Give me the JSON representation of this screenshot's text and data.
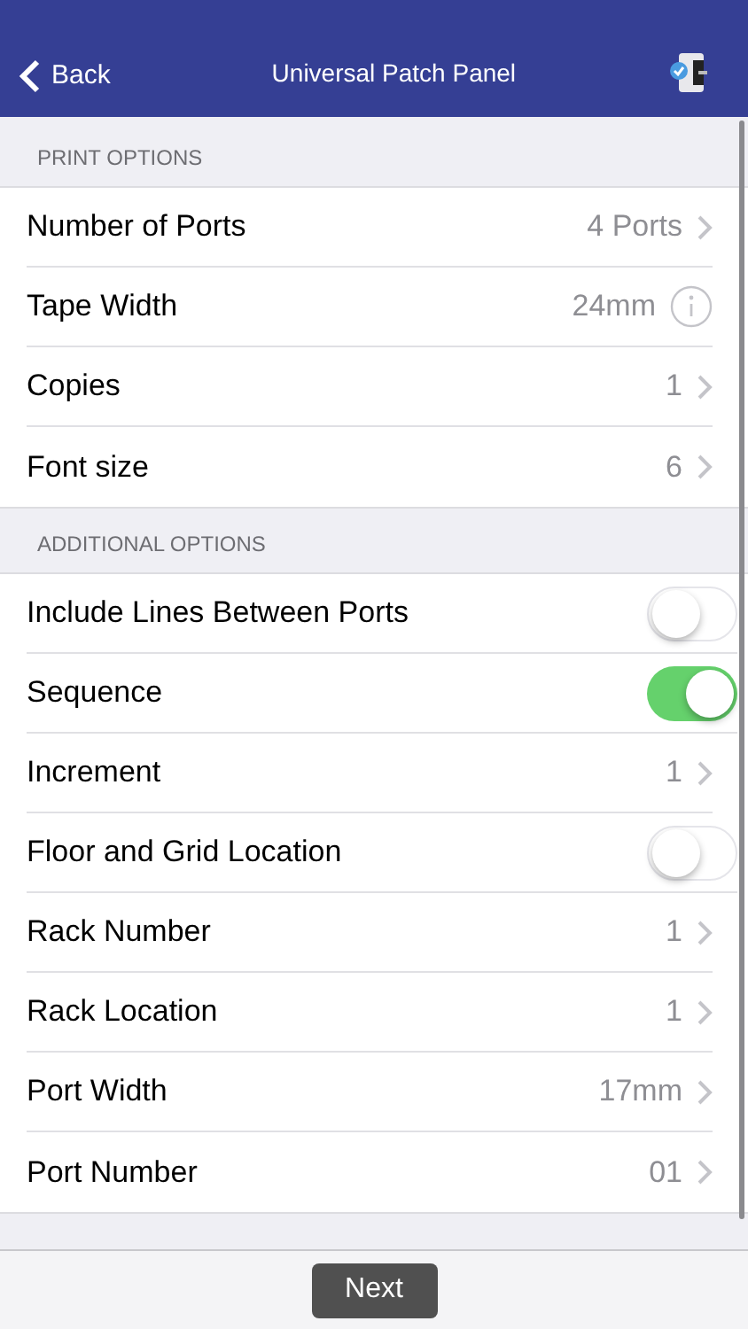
{
  "nav_bar": {
    "back": "Back",
    "title": "Universal Patch Panel"
  },
  "sections": [
    {
      "header": "PRINT OPTIONS",
      "rows": [
        {
          "kind": "disclosure",
          "label": "Number of Ports",
          "value": "4 Ports"
        },
        {
          "kind": "info",
          "label": "Tape Width",
          "value": "24mm"
        },
        {
          "kind": "disclosure",
          "label": "Copies",
          "value": "1"
        },
        {
          "kind": "disclosure",
          "label": "Font size",
          "value": "6"
        }
      ]
    },
    {
      "header": "ADDITIONAL OPTIONS",
      "rows": [
        {
          "kind": "toggle",
          "label": "Include Lines Between Ports",
          "on": false
        },
        {
          "kind": "toggle",
          "label": "Sequence",
          "on": true
        },
        {
          "kind": "disclosure",
          "label": "Increment",
          "value": "1"
        },
        {
          "kind": "toggle",
          "label": "Floor and Grid Location",
          "on": false
        },
        {
          "kind": "disclosure",
          "label": "Rack Number",
          "value": "1"
        },
        {
          "kind": "disclosure",
          "label": "Rack Location",
          "value": "1"
        },
        {
          "kind": "disclosure",
          "label": "Port Width",
          "value": "17mm"
        },
        {
          "kind": "disclosure",
          "label": "Port Number",
          "value": "01"
        }
      ]
    }
  ],
  "footer": {
    "button": "Next"
  }
}
